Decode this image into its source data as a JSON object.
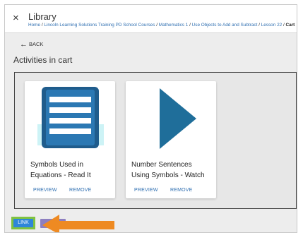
{
  "header": {
    "close_glyph": "×",
    "title": "Library",
    "breadcrumb": [
      {
        "label": "Home",
        "link": true
      },
      {
        "label": "Lincoln Learning Solutions Training PD School Courses",
        "link": true
      },
      {
        "label": "Mathematics 1",
        "link": true
      },
      {
        "label": "Use Objects to Add and Subtract",
        "link": true
      },
      {
        "label": "Lesson 22",
        "link": true
      },
      {
        "label": "Cart",
        "link": false
      }
    ],
    "separator": " / "
  },
  "back": {
    "arrow": "←",
    "label": "BACK"
  },
  "page_heading": "Activities in cart",
  "cards": [
    {
      "name_line1": "Symbols Used in",
      "name_line2": "Equations - Read It",
      "icon": "document-lines-icon",
      "preview_label": "PREVIEW",
      "remove_label": "REMOVE"
    },
    {
      "name_line1": "Number Sentences",
      "name_line2": "Using Symbols - Watch",
      "icon": "play-triangle-icon",
      "preview_label": "PREVIEW",
      "remove_label": "REMOVE"
    }
  ],
  "footer": {
    "link_label": "LINK"
  },
  "colors": {
    "accent_blue": "#2f6fb1",
    "icon_dark_blue": "#1f5c8c",
    "highlight_green": "#7fc241",
    "annotation_orange": "#ee8a22"
  }
}
